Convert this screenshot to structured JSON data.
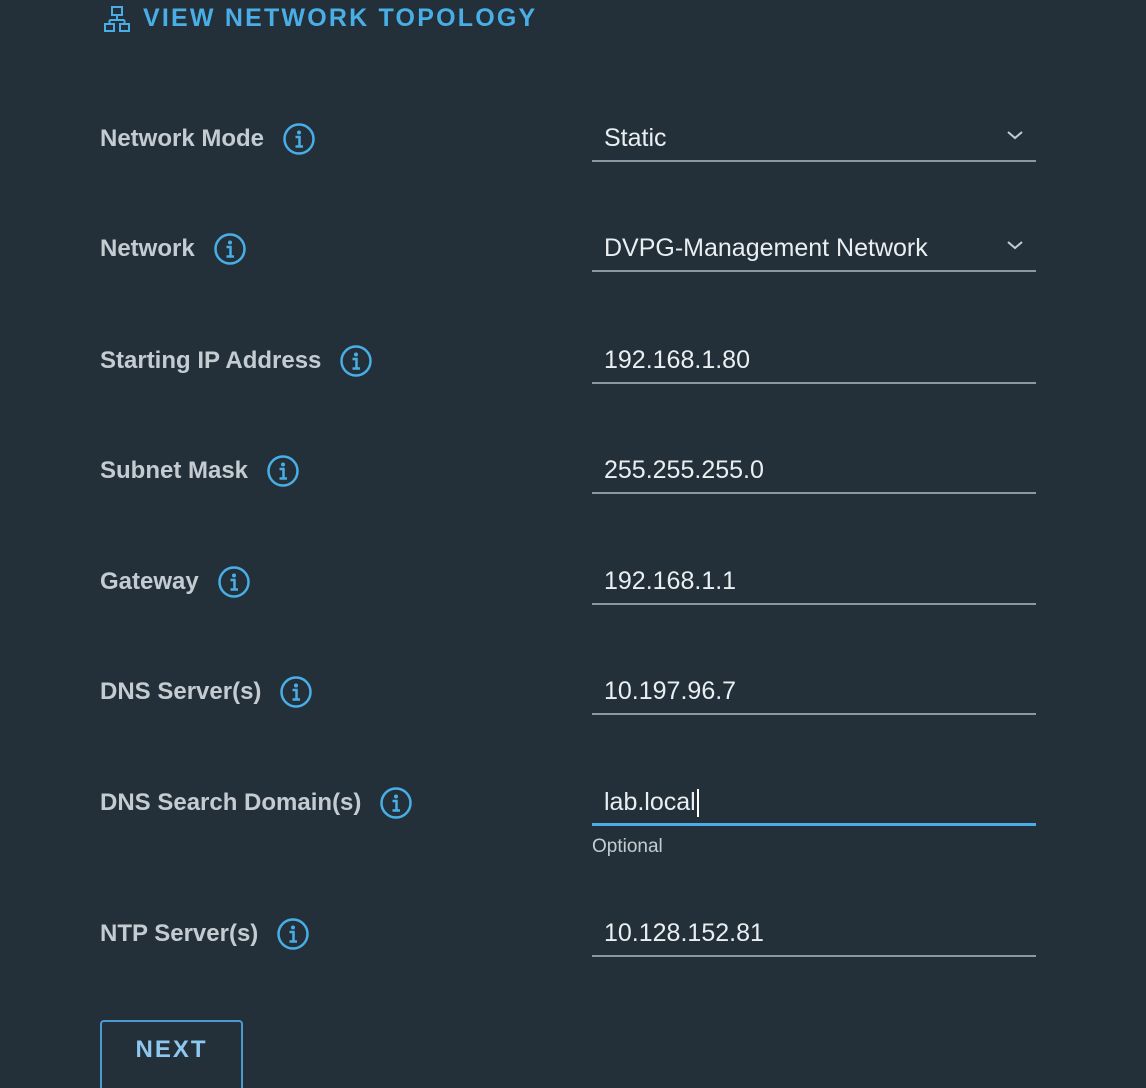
{
  "topology_link": {
    "label": "VIEW NETWORK TOPOLOGY",
    "icon": "network-topology-icon",
    "color": "#49aee6"
  },
  "form": {
    "network_mode": {
      "label": "Network Mode",
      "value": "Static",
      "type": "select"
    },
    "network": {
      "label": "Network",
      "value": "DVPG-Management Network",
      "type": "select"
    },
    "starting_ip": {
      "label": "Starting IP Address",
      "value": "192.168.1.80"
    },
    "subnet_mask": {
      "label": "Subnet Mask",
      "value": "255.255.255.0"
    },
    "gateway": {
      "label": "Gateway",
      "value": "192.168.1.1"
    },
    "dns_servers": {
      "label": "DNS Server(s)",
      "value": "10.197.96.7"
    },
    "dns_search_domains": {
      "label": "DNS Search Domain(s)",
      "value": "lab.local",
      "helper": "Optional",
      "focused": true
    },
    "ntp_servers": {
      "label": "NTP Server(s)",
      "value": "10.128.152.81"
    }
  },
  "actions": {
    "next_label": "NEXT"
  },
  "colors": {
    "background": "#23303a",
    "accent": "#49aee6",
    "input_border": "#8c979f"
  }
}
